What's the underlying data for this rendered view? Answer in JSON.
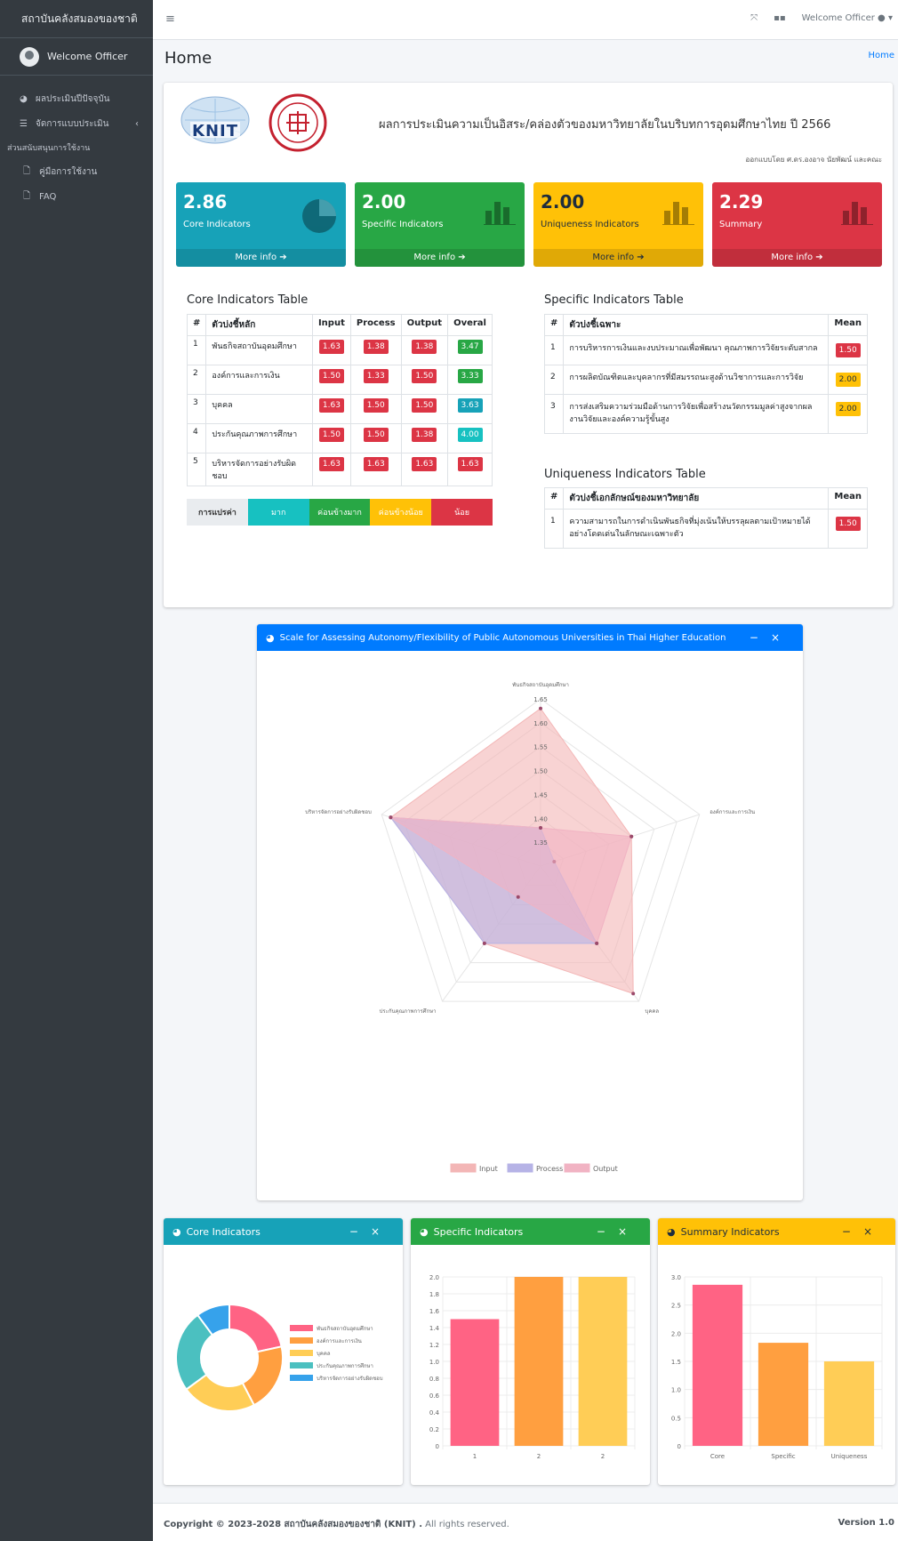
{
  "sidebar": {
    "brand": "สถาบันคลังสมองของชาติ",
    "user": "Welcome Officer",
    "nav": [
      {
        "icon": "globe-icon",
        "label": "ผลประเมินปีปัจจุบัน"
      },
      {
        "icon": "list-icon",
        "label": "จัดการแบบประเมิน",
        "expandable": true
      }
    ],
    "section": "ส่วนสนับสนุนการใช้งาน",
    "sub": [
      "คู่มือการใช้งาน",
      "FAQ"
    ]
  },
  "topbar": {
    "user": "Welcome Officer"
  },
  "page": {
    "title": "Home",
    "breadcrumb": "Home"
  },
  "header": {
    "logo_text": "KNIT",
    "title": "ผลการประเมินความเป็นอิสระ/คล่องตัวของมหาวิทยาลัยในบริบทการอุดมศึกษาไทย ปี 2566",
    "credit": "ออกแบบโดย ศ.ดร.องอาจ นัยพัฒน์ และคณะ"
  },
  "boxes": [
    {
      "value": "2.86",
      "label": "Core Indicators",
      "more": "More info",
      "color": "#17a2b8"
    },
    {
      "value": "2.00",
      "label": "Specific Indicators",
      "more": "More info",
      "color": "#28a745"
    },
    {
      "value": "2.00",
      "label": "Uniqueness Indicators",
      "more": "More info",
      "color": "#ffc107"
    },
    {
      "value": "2.29",
      "label": "Summary",
      "more": "More info",
      "color": "#dc3545"
    }
  ],
  "core_table": {
    "title": "Core Indicators Table",
    "headers": [
      "#",
      "ตัวบ่งชี้หลัก",
      "Input",
      "Process",
      "Output",
      "Overal"
    ],
    "rows": [
      {
        "n": "1",
        "name": "พันธกิจสถาบันอุดมศึกษา",
        "input": "1.63",
        "process": "1.38",
        "output": "1.38",
        "overal": "3.47"
      },
      {
        "n": "2",
        "name": "องค์การและการเงิน",
        "input": "1.50",
        "process": "1.33",
        "output": "1.50",
        "overal": "3.33"
      },
      {
        "n": "3",
        "name": "บุคคล",
        "input": "1.63",
        "process": "1.50",
        "output": "1.50",
        "overal": "3.63"
      },
      {
        "n": "4",
        "name": "ประกันคุณภาพการศึกษา",
        "input": "1.50",
        "process": "1.50",
        "output": "1.38",
        "overal": "4.00"
      },
      {
        "n": "5",
        "name": "บริหารจัดการอย่างรับผิดชอบ",
        "input": "1.63",
        "process": "1.63",
        "output": "1.63",
        "overal": "1.63"
      }
    ],
    "legend": [
      "การแปรค่า",
      "มาก",
      "ค่อนข้างมาก",
      "ค่อนข้างน้อย",
      "น้อย"
    ]
  },
  "specific_table": {
    "title": "Specific Indicators Table",
    "headers": [
      "#",
      "ตัวบ่งชี้เฉพาะ",
      "Mean"
    ],
    "rows": [
      {
        "n": "1",
        "name": "การบริหารการเงินและงบประมาณเพื่อพัฒนา คุณภาพการวิจัยระดับสากล",
        "mean": "1.50"
      },
      {
        "n": "2",
        "name": "การผลิตบัณฑิตและบุคลากรที่มีสมรรถนะสูงด้านวิชาการและการวิจัย",
        "mean": "2.00"
      },
      {
        "n": "3",
        "name": "การส่งเสริมความร่วมมือด้านการวิจัยเพื่อสร้างนวัตกรรมมูลค่าสูงจากผลงานวิจัยและองค์ความรู้ขั้นสูง",
        "mean": "2.00"
      }
    ]
  },
  "unique_table": {
    "title": "Uniqueness Indicators Table",
    "headers": [
      "#",
      "ตัวบ่งชี้เอกลักษณ์ของมหาวิทยาลัย",
      "Mean"
    ],
    "rows": [
      {
        "n": "1",
        "name": "ความสามารถในการดำเนินพันธกิจที่มุ่งเน้นให้บรรลุผลตามเป้าหมายได้อย่างโดดเด่นในลักษณะเฉพาะตัว",
        "mean": "1.50"
      }
    ]
  },
  "radar_card": {
    "title": "Scale for Assessing Autonomy/Flexibility of Public Autonomous Universities in Thai Higher Education"
  },
  "small_cards": {
    "core": "Core Indicators",
    "specific": "Specific Indicators",
    "summary": "Summary Indicators"
  },
  "colors": {
    "red": "#dc3545",
    "green": "#28a745",
    "yellow": "#ffc107",
    "cyan": "#17a2b8",
    "blue": "#007bff"
  },
  "footer": {
    "copyright": "Copyright © 2023-2028 สถาบันคลังสมองของชาติ (KNIT) .",
    "rights": " All rights reserved.",
    "version": "Version 1.0"
  },
  "chart_data": [
    {
      "type": "radar",
      "labels": [
        "พันธกิจสถาบันอุดมศึกษา",
        "องค์การและการเงิน",
        "บุคคล",
        "ประกันคุณภาพการศึกษา",
        "บริหารจัดการอย่างรับผิดชอบ"
      ],
      "ticks": [
        "1.35",
        "1.40",
        "1.45",
        "1.50",
        "1.55",
        "1.60",
        "1.65"
      ],
      "rmin": 1.3,
      "rmax": 1.65,
      "series": [
        {
          "name": "Input",
          "values": [
            1.63,
            1.5,
            1.63,
            1.5,
            1.63
          ],
          "color": "#f3b6b6"
        },
        {
          "name": "Process",
          "values": [
            1.38,
            1.33,
            1.5,
            1.5,
            1.63
          ],
          "color": "#b6b3e6"
        },
        {
          "name": "Output",
          "values": [
            1.38,
            1.5,
            1.5,
            1.38,
            1.63
          ],
          "color": "#f1b3c3"
        }
      ]
    },
    {
      "type": "pie",
      "labels": [
        "พันธกิจสถาบันอุดมศึกษา",
        "องค์การและการเงิน",
        "บุคคล",
        "ประกันคุณภาพการศึกษา",
        "บริหารจัดการอย่างรับผิดชอบ"
      ],
      "values": [
        3.47,
        3.33,
        3.63,
        4.0,
        1.63
      ],
      "colors": [
        "#ff6384",
        "#ff9f40",
        "#ffcd56",
        "#4bc0c0",
        "#36a2eb"
      ]
    },
    {
      "type": "bar",
      "categories": [
        "1",
        "2",
        "2"
      ],
      "values": [
        1.5,
        2.0,
        2.0
      ],
      "ylim": [
        0,
        2.0
      ],
      "yticks": [
        "0",
        "0.2",
        "0.4",
        "0.6",
        "0.8",
        "1.0",
        "1.2",
        "1.4",
        "1.6",
        "1.8",
        "2.0"
      ],
      "colors": [
        "#ff6384",
        "#ff9f40",
        "#ffcd56"
      ]
    },
    {
      "type": "bar",
      "categories": [
        "Core",
        "Specific",
        "Uniqueness"
      ],
      "values": [
        2.86,
        1.83,
        1.5
      ],
      "ylim": [
        0,
        3.0
      ],
      "yticks": [
        "0",
        "0.5",
        "1.0",
        "1.5",
        "2.0",
        "2.5",
        "3.0"
      ],
      "colors": [
        "#ff6384",
        "#ff9f40",
        "#ffcd56"
      ]
    }
  ]
}
